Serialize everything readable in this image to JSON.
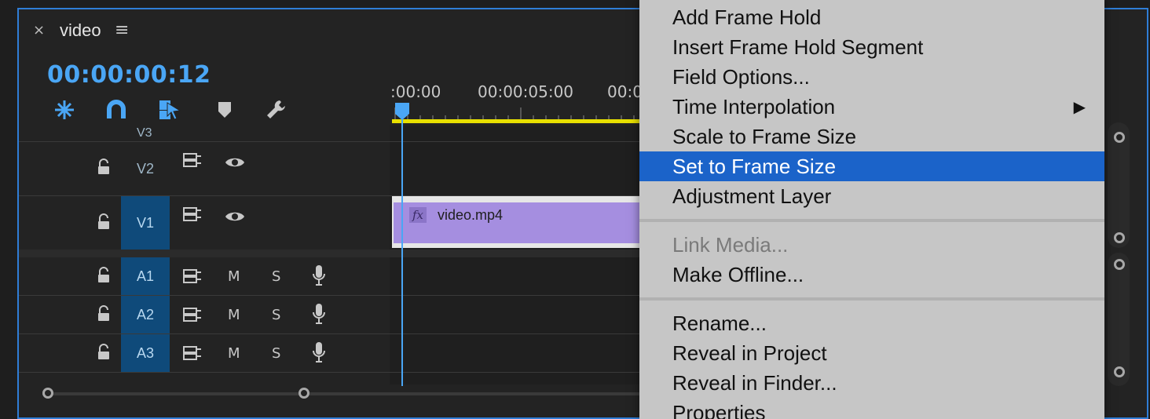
{
  "panel": {
    "title": "video",
    "close_glyph": "×",
    "menu_glyph": "≡",
    "timecode": "00:00:00:12"
  },
  "toolbar": {
    "icons": [
      "snap-icon",
      "magnet-icon",
      "linked-selection-icon",
      "add-marker-icon",
      "wrench-icon"
    ]
  },
  "ruler": {
    "labels": [
      ":00:00",
      "00:00:05:00",
      "00:0"
    ]
  },
  "tracks": [
    {
      "name": "V3"
    },
    {
      "name": "V2",
      "active": false
    },
    {
      "name": "V1",
      "active": true
    },
    {
      "name": "A1",
      "active": true,
      "m": "M",
      "s": "S"
    },
    {
      "name": "A2",
      "active": true,
      "m": "M",
      "s": "S"
    },
    {
      "name": "A3",
      "active": true,
      "m": "M",
      "s": "S"
    }
  ],
  "clip": {
    "fx": "fx",
    "name": "video.mp4"
  },
  "context_menu": {
    "items": [
      {
        "label": "Add Frame Hold"
      },
      {
        "label": "Insert Frame Hold Segment"
      },
      {
        "label": "Field Options..."
      },
      {
        "label": "Time Interpolation",
        "submenu_glyph": "▶"
      },
      {
        "label": "Scale to Frame Size"
      },
      {
        "label": "Set to Frame Size",
        "selected": true
      },
      {
        "label": "Adjustment Layer"
      },
      {
        "label": "Link Media...",
        "disabled": true
      },
      {
        "label": "Make Offline..."
      },
      {
        "label": "Rename..."
      },
      {
        "label": "Reveal in Project"
      },
      {
        "label": "Reveal in Finder..."
      },
      {
        "label": "Properties"
      }
    ]
  },
  "colors": {
    "accent": "#2f7dd6",
    "timecode": "#4aa6f5",
    "selected_menu": "#1b63c9",
    "clip": "#a58ee0",
    "active_track": "#0f4a7a",
    "workarea": "#e8e000"
  }
}
